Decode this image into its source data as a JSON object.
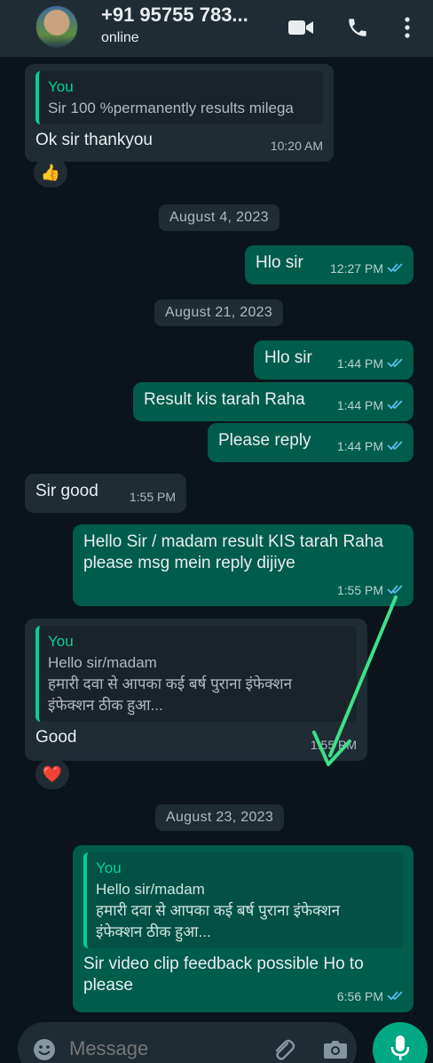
{
  "header": {
    "contact_name": "+91 95755 783...",
    "status": "online"
  },
  "messages": [
    {
      "quote_author": "You",
      "quote_text": "Sir 100 %permanently results milega",
      "text": "Ok sir thankyou",
      "time": "10:20 AM",
      "reaction": "👍"
    },
    {
      "date": "August 4, 2023"
    },
    {
      "text": "Hlo sir",
      "time": "12:27 PM"
    },
    {
      "date": "August 21, 2023"
    },
    {
      "text": "Hlo sir",
      "time": "1:44 PM"
    },
    {
      "text": "Result kis tarah Raha",
      "time": "1:44 PM"
    },
    {
      "text": "Please reply",
      "time": "1:44 PM"
    },
    {
      "text": "Sir good",
      "time": "1:55 PM"
    },
    {
      "text": "Hello Sir / madam result KIS tarah Raha please msg mein reply dijiye",
      "time": "1:55 PM"
    },
    {
      "quote_author": "You",
      "quote_line1": "Hello sir/madam",
      "quote_line2": "हमारी दवा से आपका कई बर्ष पुराना इंफेक्शन",
      "quote_line3": "इंफेक्शन ठीक हुआ...",
      "text": "Good",
      "time": "1:55 PM",
      "reaction": "❤️"
    },
    {
      "date": "August 23, 2023"
    },
    {
      "quote_author": "You",
      "quote_line1": "Hello sir/madam",
      "quote_line2": "हमारी दवा से आपका कई बर्ष पुराना इंफेक्शन",
      "quote_line3": "इंफेक्शन ठीक हुआ...",
      "text": "Sir video clip feedback possible Ho to please",
      "time": "6:56 PM"
    }
  ],
  "composer": {
    "placeholder": "Message"
  },
  "icons": [
    "video-call-icon",
    "phone-icon",
    "more-options-icon",
    "emoji-icon",
    "attach-icon",
    "camera-icon",
    "mic-icon",
    "double-tick-icon"
  ],
  "colors": {
    "header_bg": "#1f2c34",
    "chat_bg": "#0b141a",
    "incoming_bubble": "#1f2c34",
    "outgoing_bubble": "#005c4b",
    "read_tick": "#53bdeb",
    "accent": "#00a884",
    "annotation_arrow": "#3ee08a"
  }
}
